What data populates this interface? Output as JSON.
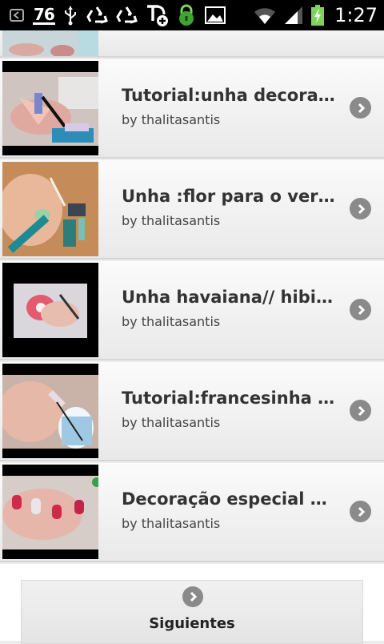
{
  "status_bar": {
    "notification_count": "76",
    "time": "1:27",
    "icons": [
      "back-notification-icon",
      "usb-icon",
      "recycle-icon",
      "recycle-icon",
      "t-plus-icon",
      "lock-icon",
      "image-icon",
      "wifi-icon",
      "signal-icon",
      "battery-icon"
    ]
  },
  "videos": [
    {
      "title": "Tutorial:unha decorada com caviar",
      "author": "by thalitasantis"
    },
    {
      "title": "Unha :flor para o verão",
      "author": "by thalitasantis"
    },
    {
      "title": "Unha havaiana// hibisco",
      "author": "by thalitasantis"
    },
    {
      "title": "Tutorial:francesinha decorada",
      "author": "by thalitasantis"
    },
    {
      "title": "Decoração especial unhas",
      "author": "by thalitasantis"
    }
  ],
  "next": {
    "label": "Siguientes"
  }
}
